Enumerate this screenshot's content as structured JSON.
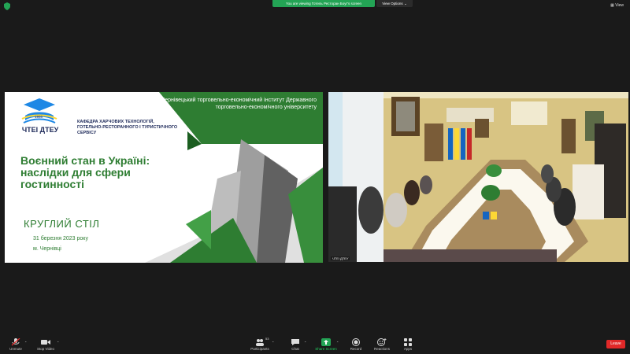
{
  "banner": {
    "share_text": "You are viewing Готель Ресторан Боуг's screen",
    "view_options_label": "View Options",
    "view_label": "View"
  },
  "slide": {
    "logo_year": "1966",
    "logo_text": "ЧТЕІ ДТЕУ",
    "department": "КАФЕДРА ХАРЧОВИХ ТЕХНОЛОГІЙ, ГОТЕЛЬНО-РЕСТОРАННОГО І ТУРИСТИЧНОГО СЕРВІСУ",
    "institute": "Чернівецький торговельно-економічний інститут Державного торговельно-економічного університету",
    "title": "Воєнний стан в Україні: наслідки для сфери гостинності",
    "subtitle": "КРУГЛИЙ СТІЛ",
    "date": "31 березня 2023 року",
    "city": "м. Чернівці"
  },
  "camera": {
    "label": "ЧТЕІ ДТЕУ"
  },
  "toolbar": {
    "unmute_label": "Unmute",
    "video_label": "Stop Video",
    "participants_label": "Participants",
    "participants_count": "53",
    "chat_label": "Chat",
    "share_label": "Share Screen",
    "record_label": "Record",
    "reactions_label": "Reactions",
    "apps_label": "Apps",
    "leave_label": "Leave"
  },
  "colors": {
    "share_green": "#23a455",
    "slide_green": "#2e7d32",
    "leave_red": "#e02828"
  }
}
